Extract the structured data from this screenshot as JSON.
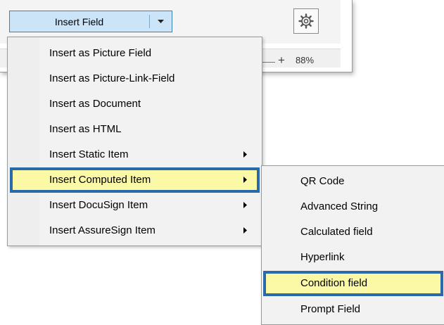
{
  "toolbar": {
    "split_button_label": "Insert Field",
    "split_arrow_icon": "chevron-down-icon",
    "settings_icon": "gear-icon"
  },
  "statusbar": {
    "zoom_plus": "+",
    "zoom_level": "88%"
  },
  "menu": {
    "items": [
      {
        "label": "Insert as Picture Field",
        "has_submenu": false
      },
      {
        "label": "Insert as Picture-Link-Field",
        "has_submenu": false
      },
      {
        "label": "Insert as Document",
        "has_submenu": false
      },
      {
        "label": "Insert as HTML",
        "has_submenu": false
      },
      {
        "label": "Insert Static Item",
        "has_submenu": true
      },
      {
        "label": "Insert Computed Item",
        "has_submenu": true,
        "highlighted": true
      },
      {
        "label": "Insert DocuSign Item",
        "has_submenu": true
      },
      {
        "label": "Insert AssureSign Item",
        "has_submenu": true
      }
    ]
  },
  "submenu": {
    "items": [
      {
        "label": "QR Code"
      },
      {
        "label": "Advanced String"
      },
      {
        "label": "Calculated field"
      },
      {
        "label": "Hyperlink"
      },
      {
        "label": "Condition field",
        "highlighted": true
      },
      {
        "label": "Prompt Field"
      }
    ]
  },
  "colors": {
    "highlight_fill": "#fbf8a6",
    "highlight_border": "#2c69a8",
    "button_fill": "#cce4f7",
    "button_border": "#3c7fb1"
  }
}
